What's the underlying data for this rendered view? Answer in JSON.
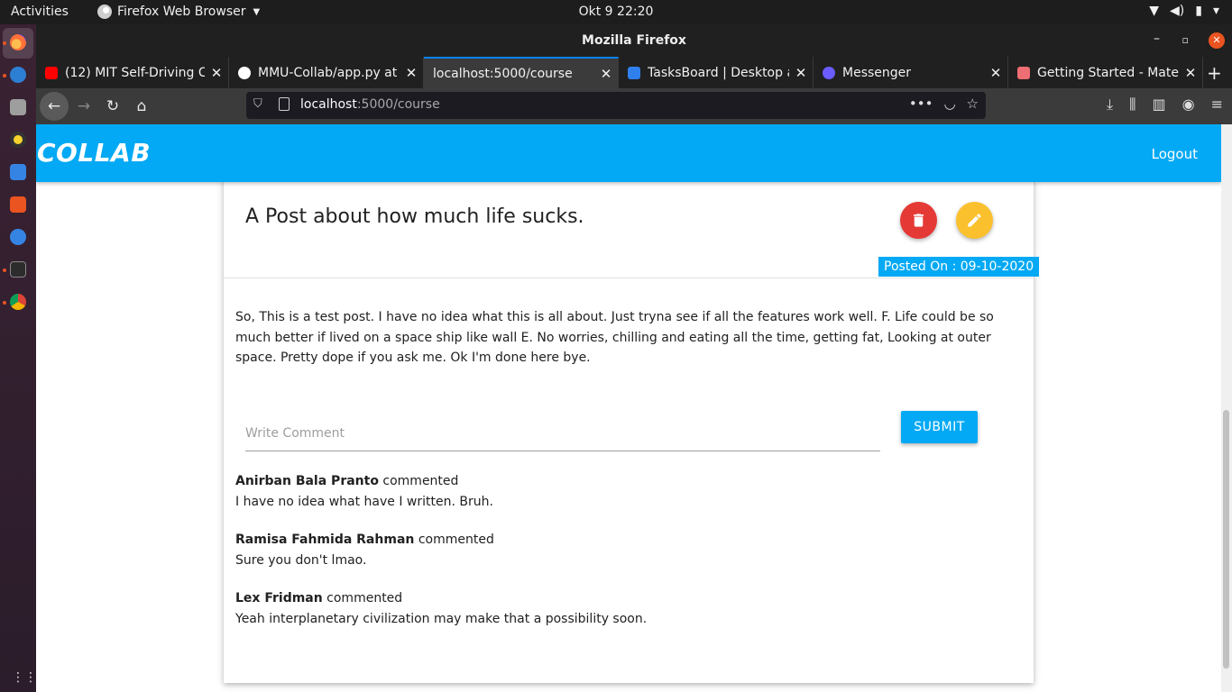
{
  "system": {
    "activities": "Activities",
    "app_menu": "Firefox Web Browser",
    "clock": "Okt 9  22:20",
    "tray_icons": [
      "wifi-icon",
      "volume-icon",
      "battery-icon",
      "power-menu-icon"
    ]
  },
  "dock": {
    "items": [
      "firefox-icon",
      "thunderbird-icon",
      "files-icon",
      "rhythmbox-icon",
      "libreoffice-writer-icon",
      "software-center-icon",
      "help-icon",
      "terminal-icon",
      "chrome-icon"
    ],
    "show_apps": "⋮⋮⋮"
  },
  "window": {
    "title": "Mozilla Firefox"
  },
  "tabs": [
    {
      "label": "(12) MIT Self-Driving Ca",
      "active": false,
      "favicon_color": "#ff0000"
    },
    {
      "label": "MMU-Collab/app.py at",
      "active": false,
      "favicon_color": "#ffffff"
    },
    {
      "label": "localhost:5000/course",
      "active": true,
      "favicon_color": ""
    },
    {
      "label": "TasksBoard | Desktop a",
      "active": false,
      "favicon_color": "#2f80ed"
    },
    {
      "label": "Messenger",
      "active": false,
      "favicon_color": "#6a5cff"
    },
    {
      "label": "Getting Started - Mater",
      "active": false,
      "favicon_color": "#ee6e73"
    }
  ],
  "urlbar": {
    "host": "localhost",
    "path": ":5000/course"
  },
  "page": {
    "brand": "COLLAB",
    "logout": "Logout",
    "post": {
      "title": "A Post about how much life sucks.",
      "posted_on": "Posted On : 09-10-2020",
      "body": "So, This is a test post. I have no idea what this is all about. Just tryna see if all the features work well. F. Life could be so much better if lived on a space ship like wall E. No worries, chilling and eating all the time, getting fat, Looking at outer space. Pretty dope if you ask me. Ok I'm done here bye."
    },
    "comment_form": {
      "placeholder": "Write Comment",
      "value": "",
      "submit_label": "SUBMIT"
    },
    "commented_word": "commented",
    "comments": [
      {
        "author": "Anirban Bala Pranto",
        "text": "I have no idea what have I written. Bruh."
      },
      {
        "author": "Ramisa Fahmida Rahman",
        "text": "Sure you don't lmao."
      },
      {
        "author": "Lex Fridman",
        "text": "Yeah interplanetary civilization may make that a possibility soon."
      }
    ]
  },
  "colors": {
    "accent": "#03a9f4",
    "delete": "#e53935",
    "edit": "#fbc02d"
  }
}
